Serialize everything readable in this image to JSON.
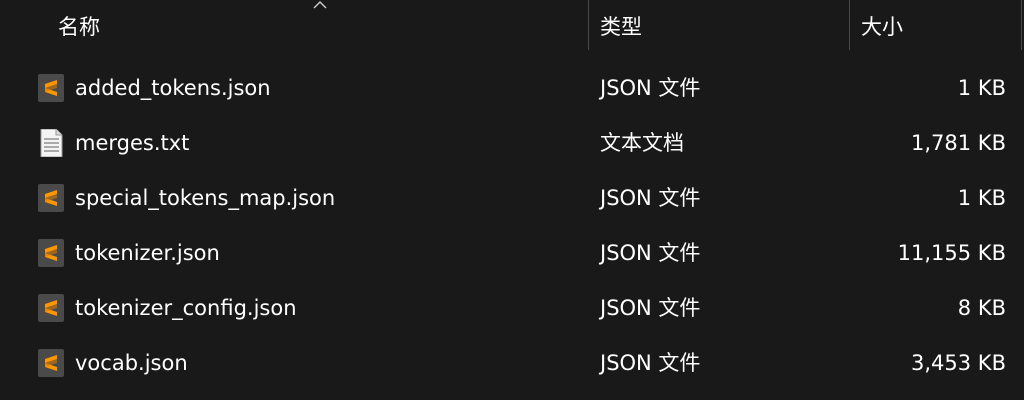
{
  "header": {
    "sort_indicator": "chevron-up-icon",
    "columns": [
      {
        "label": "名称"
      },
      {
        "label": "类型"
      },
      {
        "label": "大小"
      }
    ]
  },
  "files": [
    {
      "name": "added_tokens.json",
      "type": "JSON 文件",
      "size": "1 KB",
      "icon": "sublime-text-icon"
    },
    {
      "name": "merges.txt",
      "type": "文本文档",
      "size": "1,781 KB",
      "icon": "text-document-icon"
    },
    {
      "name": "special_tokens_map.json",
      "type": "JSON 文件",
      "size": "1 KB",
      "icon": "sublime-text-icon"
    },
    {
      "name": "tokenizer.json",
      "type": "JSON 文件",
      "size": "11,155 KB",
      "icon": "sublime-text-icon"
    },
    {
      "name": "tokenizer_config.json",
      "type": "JSON 文件",
      "size": "8 KB",
      "icon": "sublime-text-icon"
    },
    {
      "name": "vocab.json",
      "type": "JSON 文件",
      "size": "3,453 KB",
      "icon": "sublime-text-icon"
    }
  ],
  "colors": {
    "background": "#191919",
    "text": "#ffffff",
    "divider": "#4a4a4a",
    "sublime_icon_bg": "#4a4a4a",
    "sublime_icon_accent": "#ff9800"
  }
}
